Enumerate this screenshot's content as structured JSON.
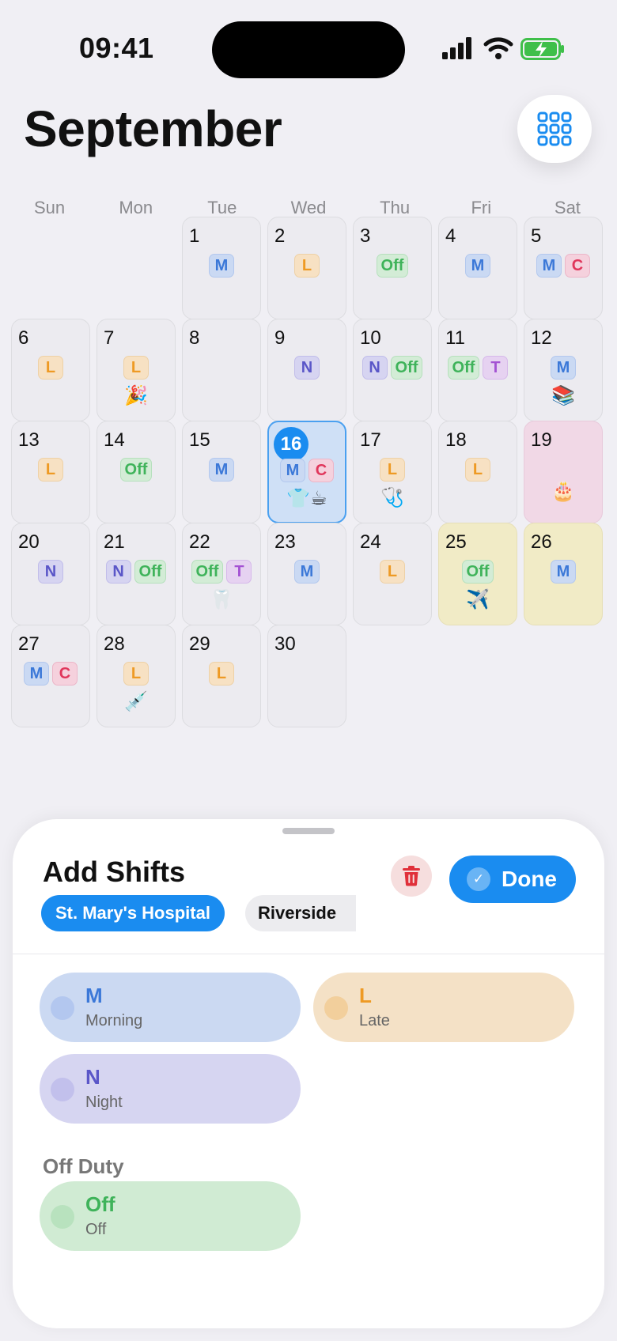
{
  "status": {
    "time": "09:41"
  },
  "header": {
    "month": "September"
  },
  "weekdays": [
    "Sun",
    "Mon",
    "Tue",
    "Wed",
    "Thu",
    "Fri",
    "Sat"
  ],
  "days": [
    {
      "day": "1",
      "badges": [
        {
          "t": "M",
          "k": "M"
        }
      ],
      "emoji": ""
    },
    {
      "day": "2",
      "badges": [
        {
          "t": "L",
          "k": "L"
        }
      ],
      "emoji": ""
    },
    {
      "day": "3",
      "badges": [
        {
          "t": "Off",
          "k": "Off"
        }
      ],
      "emoji": ""
    },
    {
      "day": "4",
      "badges": [
        {
          "t": "M",
          "k": "M"
        }
      ],
      "emoji": ""
    },
    {
      "day": "5",
      "badges": [
        {
          "t": "M",
          "k": "M"
        },
        {
          "t": "C",
          "k": "C"
        }
      ],
      "emoji": ""
    },
    {
      "day": "6",
      "badges": [
        {
          "t": "L",
          "k": "L"
        }
      ],
      "emoji": ""
    },
    {
      "day": "7",
      "badges": [
        {
          "t": "L",
          "k": "L"
        }
      ],
      "emoji": "🎉"
    },
    {
      "day": "8",
      "badges": [],
      "emoji": ""
    },
    {
      "day": "9",
      "badges": [
        {
          "t": "N",
          "k": "N"
        }
      ],
      "emoji": ""
    },
    {
      "day": "10",
      "badges": [
        {
          "t": "N",
          "k": "N"
        },
        {
          "t": "Off",
          "k": "Off"
        }
      ],
      "emoji": ""
    },
    {
      "day": "11",
      "badges": [
        {
          "t": "Off",
          "k": "Off"
        },
        {
          "t": "T",
          "k": "T"
        }
      ],
      "emoji": ""
    },
    {
      "day": "12",
      "badges": [
        {
          "t": "M",
          "k": "M"
        }
      ],
      "emoji": "📚"
    },
    {
      "day": "13",
      "badges": [
        {
          "t": "L",
          "k": "L"
        }
      ],
      "emoji": ""
    },
    {
      "day": "14",
      "badges": [
        {
          "t": "Off",
          "k": "Off"
        }
      ],
      "emoji": ""
    },
    {
      "day": "15",
      "badges": [
        {
          "t": "M",
          "k": "M"
        }
      ],
      "emoji": ""
    },
    {
      "day": "16",
      "badges": [
        {
          "t": "M",
          "k": "M"
        },
        {
          "t": "C",
          "k": "C"
        }
      ],
      "emoji": "👕☕",
      "today": true
    },
    {
      "day": "17",
      "badges": [
        {
          "t": "L",
          "k": "L"
        }
      ],
      "emoji": "🩺"
    },
    {
      "day": "18",
      "badges": [
        {
          "t": "L",
          "k": "L"
        }
      ],
      "emoji": ""
    },
    {
      "day": "19",
      "badges": [],
      "emoji": "🎂",
      "tint": "pink"
    },
    {
      "day": "20",
      "badges": [
        {
          "t": "N",
          "k": "N"
        }
      ],
      "emoji": ""
    },
    {
      "day": "21",
      "badges": [
        {
          "t": "N",
          "k": "N"
        },
        {
          "t": "Off",
          "k": "Off"
        }
      ],
      "emoji": ""
    },
    {
      "day": "22",
      "badges": [
        {
          "t": "Off",
          "k": "Off"
        },
        {
          "t": "T",
          "k": "T"
        }
      ],
      "emoji": "🦷"
    },
    {
      "day": "23",
      "badges": [
        {
          "t": "M",
          "k": "M"
        }
      ],
      "emoji": ""
    },
    {
      "day": "24",
      "badges": [
        {
          "t": "L",
          "k": "L"
        }
      ],
      "emoji": ""
    },
    {
      "day": "25",
      "badges": [
        {
          "t": "Off",
          "k": "Off"
        }
      ],
      "emoji": "✈️",
      "tint": "yellow"
    },
    {
      "day": "26",
      "badges": [
        {
          "t": "M",
          "k": "M"
        }
      ],
      "emoji": "",
      "tint": "yellow"
    },
    {
      "day": "27",
      "badges": [
        {
          "t": "M",
          "k": "M"
        },
        {
          "t": "C",
          "k": "C"
        }
      ],
      "emoji": ""
    },
    {
      "day": "28",
      "badges": [
        {
          "t": "L",
          "k": "L"
        }
      ],
      "emoji": "💉"
    },
    {
      "day": "29",
      "badges": [
        {
          "t": "L",
          "k": "L"
        }
      ],
      "emoji": ""
    },
    {
      "day": "30",
      "badges": [],
      "emoji": ""
    }
  ],
  "sheet": {
    "title": "Add Shifts",
    "done_label": "Done",
    "locations": [
      "St. Mary's Hospital",
      "Riverside"
    ],
    "off_section": "Off Duty",
    "shifts": [
      {
        "code": "M",
        "name": "Morning",
        "k": "M"
      },
      {
        "code": "L",
        "name": "Late",
        "k": "L"
      },
      {
        "code": "N",
        "name": "Night",
        "k": "N"
      }
    ],
    "off_shift": {
      "code": "Off",
      "name": "Off",
      "k": "Off"
    }
  }
}
